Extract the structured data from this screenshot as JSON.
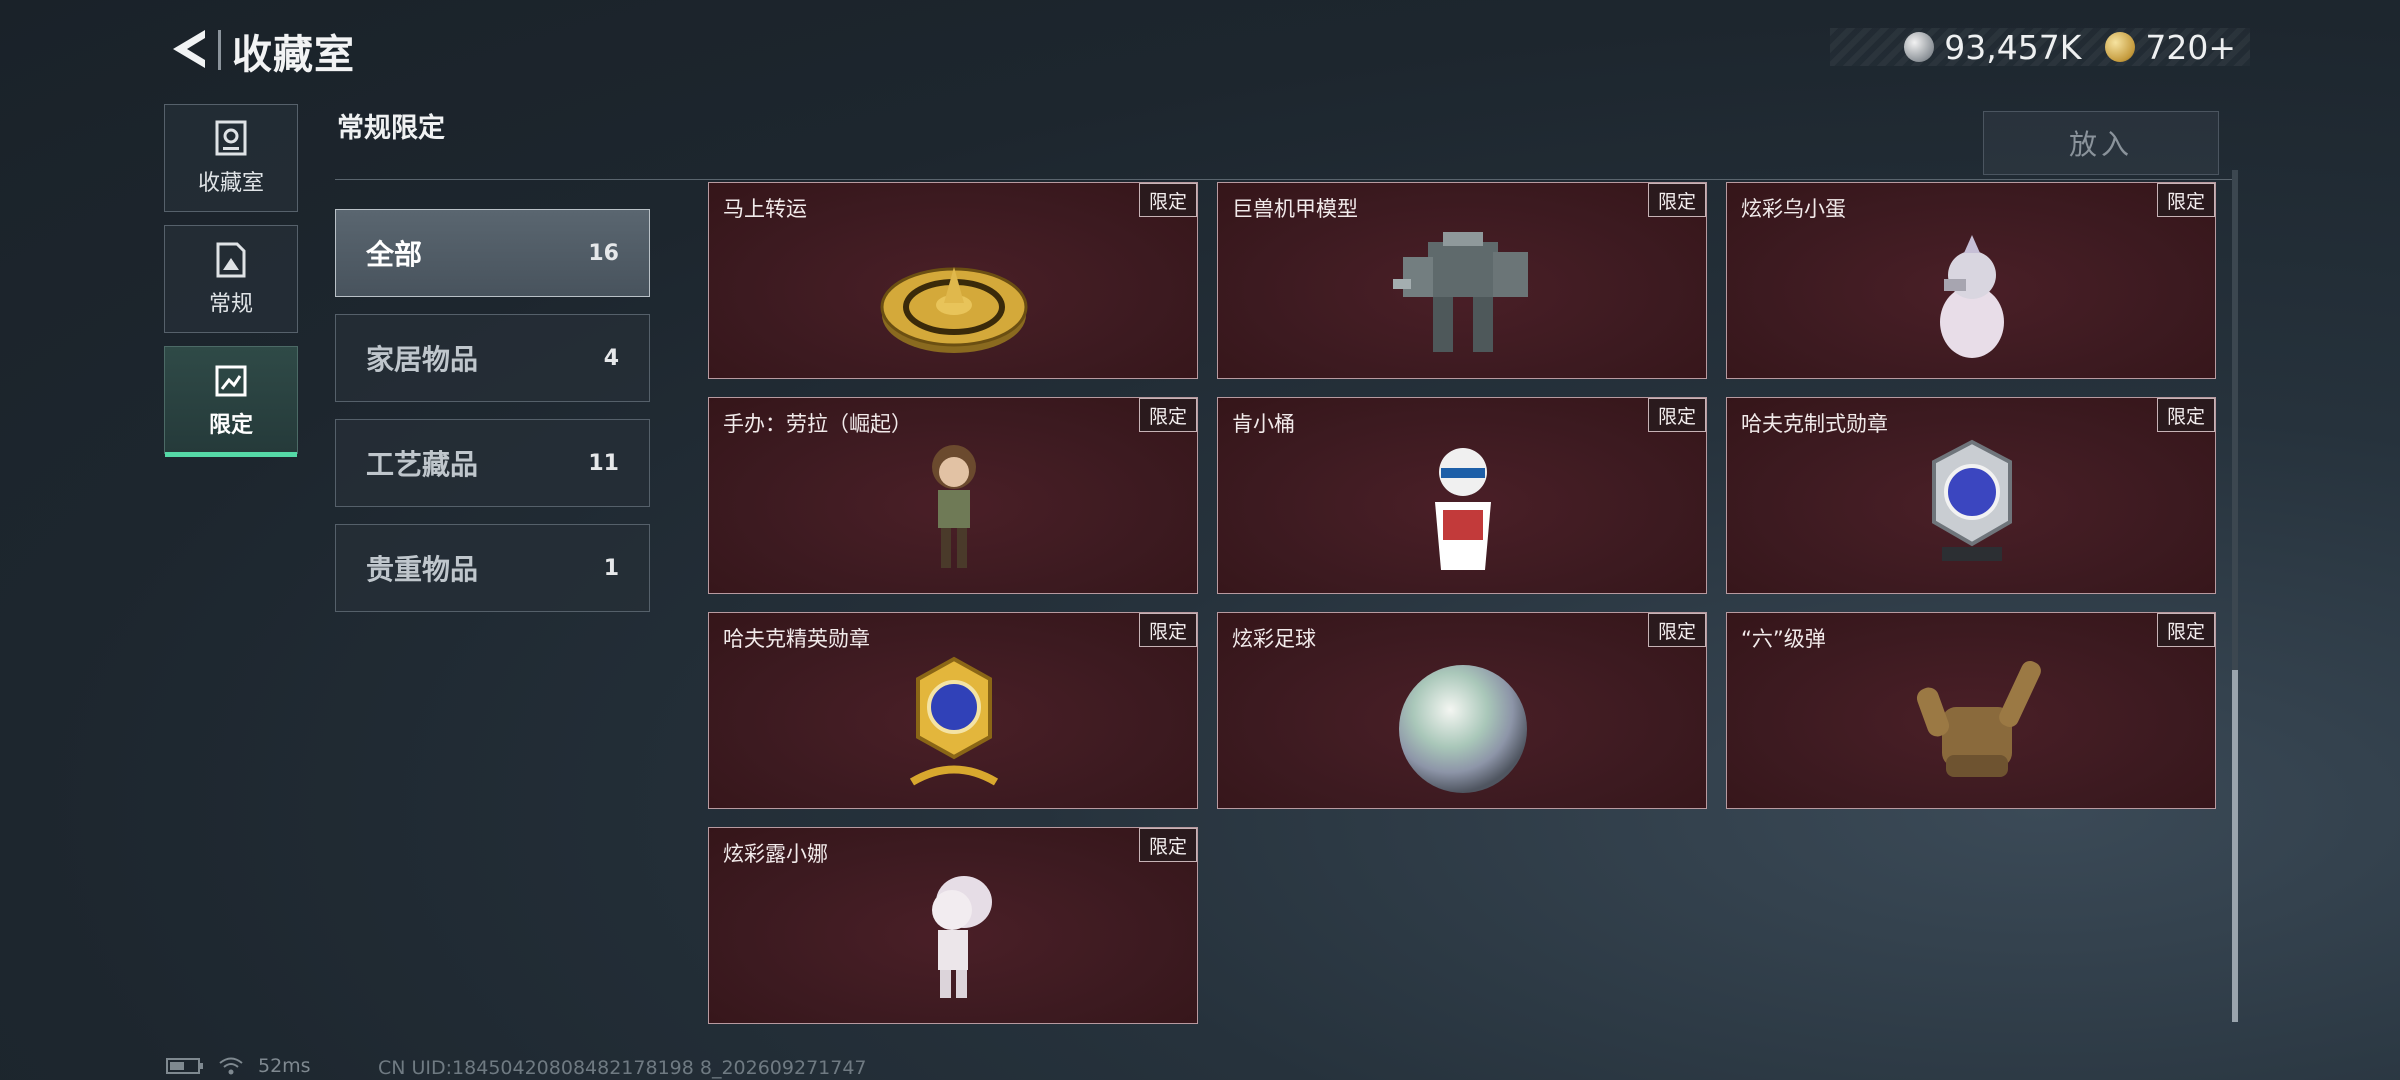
{
  "header": {
    "title": "收藏室",
    "back_icon": "back-arrow-icon"
  },
  "currency": {
    "silver_value": "93,457K",
    "gold_value": "720+",
    "silver_icon": "silver-coin-icon",
    "gold_icon": "gold-coin-icon"
  },
  "nav": [
    {
      "label": "收藏室",
      "icon": "trophy-cup-icon",
      "active": false
    },
    {
      "label": "常规",
      "icon": "document-icon",
      "active": false
    },
    {
      "label": "限定",
      "icon": "limited-image-icon",
      "active": true
    }
  ],
  "section": {
    "title": "常规限定",
    "put_in_label": "放入"
  },
  "categories": [
    {
      "name": "全部",
      "count": "16",
      "active": true
    },
    {
      "name": "家居物品",
      "count": "4",
      "active": false
    },
    {
      "name": "工艺藏品",
      "count": "11",
      "active": false
    },
    {
      "name": "贵重物品",
      "count": "1",
      "active": false
    }
  ],
  "items": [
    {
      "name": "马上转运",
      "badge": "限定",
      "art": "golden-wheel"
    },
    {
      "name": "巨兽机甲模型",
      "badge": "限定",
      "art": "mech-model"
    },
    {
      "name": "炫彩乌小蛋",
      "badge": "限定",
      "art": "egg-figure"
    },
    {
      "name": "手办：劳拉（崛起）",
      "badge": "限定",
      "art": "lara-figure"
    },
    {
      "name": "肯小桶",
      "badge": "限定",
      "art": "bucket-figure"
    },
    {
      "name": "哈夫克制式勋章",
      "badge": "限定",
      "art": "silver-medal"
    },
    {
      "name": "哈夫克精英勋章",
      "badge": "限定",
      "art": "gold-medal"
    },
    {
      "name": "炫彩足球",
      "badge": "限定",
      "art": "iridescent-ball"
    },
    {
      "name": "“六”级弹",
      "badge": "限定",
      "art": "bronze-hand"
    },
    {
      "name": "炫彩露小娜",
      "badge": "限定",
      "art": "white-girl-figure"
    }
  ],
  "status": {
    "battery_icon": "battery-icon",
    "wifi_icon": "wifi-icon",
    "ping": "52ms",
    "uid": "CN UID:18450420808482178198 8_202609271747"
  }
}
